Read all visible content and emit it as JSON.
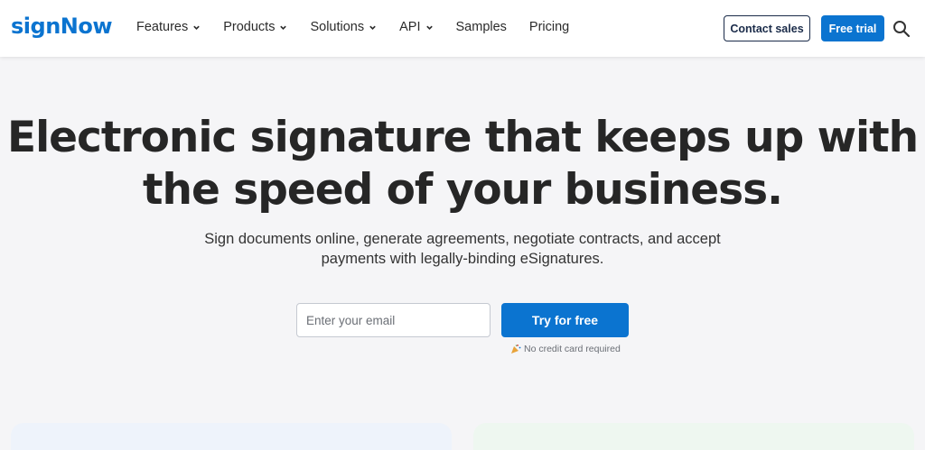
{
  "brand": {
    "logo_text": "signNow",
    "accent_color": "#0b74d0"
  },
  "nav": {
    "items": [
      {
        "label": "Features",
        "has_dropdown": true
      },
      {
        "label": "Products",
        "has_dropdown": true
      },
      {
        "label": "Solutions",
        "has_dropdown": true
      },
      {
        "label": "API",
        "has_dropdown": true
      },
      {
        "label": "Samples",
        "has_dropdown": false
      },
      {
        "label": "Pricing",
        "has_dropdown": false
      }
    ],
    "contact_sales": "Contact sales",
    "free_trial": "Free trial",
    "search_icon": "search-icon"
  },
  "hero": {
    "headline_line1": "Electronic signature that keeps up with",
    "headline_line2": "the speed of your business.",
    "subline_line1": "Sign documents online, generate agreements, negotiate contracts, and accept",
    "subline_line2": "payments with legally-binding eSignatures.",
    "email_placeholder": "Enter your email",
    "email_value": "",
    "cta_label": "Try for free",
    "note": "No credit card required",
    "note_icon": "party-popper-icon"
  }
}
